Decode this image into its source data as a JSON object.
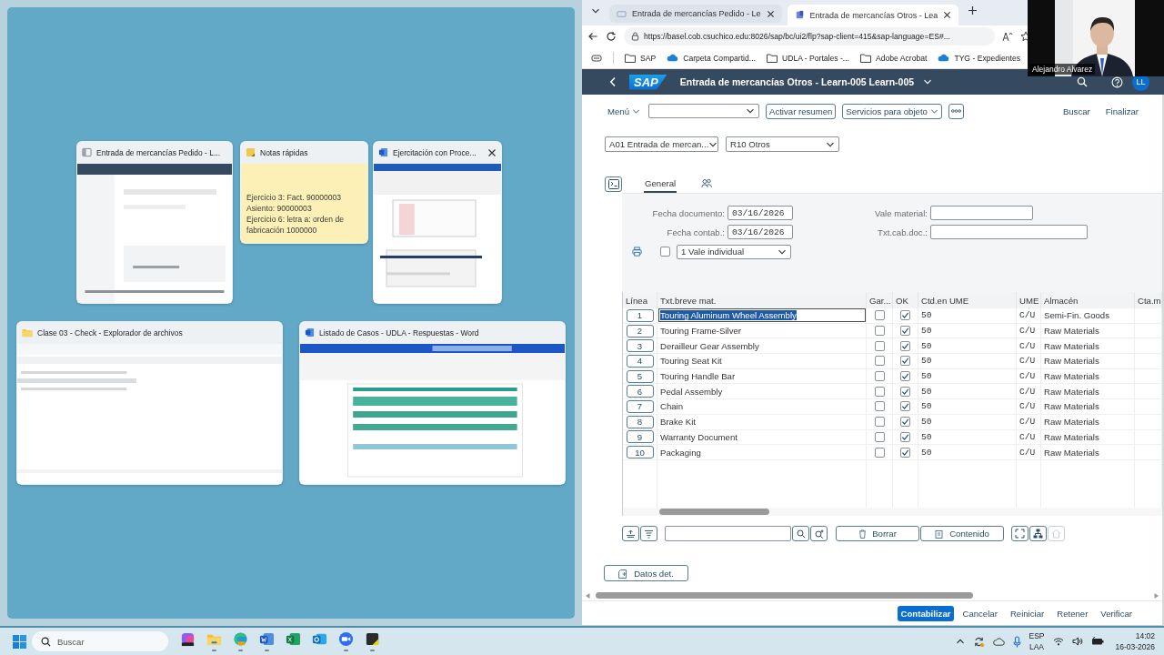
{
  "task_view": {
    "windows": [
      {
        "kind": "browser",
        "title": "Entrada de mercancías Pedido - L...",
        "hovered": false
      },
      {
        "kind": "notes",
        "title": "Notas rápidas",
        "hovered": false,
        "lines": [
          "Ejercicio 3: Fact. 90000003",
          "Asiento: 90000003",
          "Ejercicio 6: letra a: orden de fabricación 1000000"
        ]
      },
      {
        "kind": "document",
        "title": "Ejercitación con Proce...",
        "hovered": true
      },
      {
        "kind": "explorer",
        "title": "Clase 03 - Check - Explorador de archivos",
        "hovered": false
      },
      {
        "kind": "word",
        "title": "Listado de Casos - UDLA - Respuestas - Word",
        "hovered": false
      }
    ]
  },
  "webcam": {
    "name": "Alejandro Alvarez"
  },
  "browser": {
    "tabs": [
      {
        "label": "Entrada de mercancías Pedido - Le",
        "selected": false
      },
      {
        "label": "Entrada de mercancías Otros - Lea",
        "selected": true
      }
    ],
    "address": "https://basel.cob.csuchico.edu:8026/sap/bc/ui2/flp?sap-client=415&sap-language=ES#...",
    "bookmarks": [
      {
        "label": "SAP",
        "kind": "folder"
      },
      {
        "label": "Carpeta Compartid...",
        "kind": "cloud"
      },
      {
        "label": "UDLA - Portales -...",
        "kind": "folder"
      },
      {
        "label": "Adobe Acrobat",
        "kind": "folder"
      },
      {
        "label": "TYG - Expedientes",
        "kind": "cloud"
      }
    ]
  },
  "shell": {
    "logo": "SAP",
    "title": "Entrada de mercancías Otros - Learn-005 Learn-005",
    "avatar": "LL"
  },
  "toolbar": {
    "menu": "Menú",
    "buttons": [
      {
        "label": "Activar resumen",
        "kind": "plain"
      },
      {
        "label": "Servicios para objeto",
        "kind": "menu"
      }
    ],
    "links": [
      "Buscar",
      "Finalizar"
    ]
  },
  "selectors": [
    "A01 Entrada de mercan...",
    "R10 Otros"
  ],
  "tabs": [
    {
      "kind": "text",
      "label": "General",
      "selected": true
    },
    {
      "kind": "icon",
      "selected": false
    }
  ],
  "header_fields": [
    {
      "label": "Fecha documento:",
      "value": "03/16/2026"
    },
    {
      "label": "Vale material:"
    },
    {
      "label": "Fecha contab.:",
      "value": "03/16/2026"
    },
    {
      "label": "Txt.cab.doc.:"
    }
  ],
  "print": {
    "checked": false,
    "option": "1 Vale individual"
  },
  "table": {
    "columns": [
      "Línea",
      "Txt.breve mat.",
      "Gar...",
      "OK",
      "Ctd.en UME",
      "UME",
      "Almacén",
      "Cta.m"
    ],
    "rows": [
      {
        "line": "1",
        "material": "Touring Aluminum Wheel Assembly",
        "editing": true,
        "gar": false,
        "ok": true,
        "qty": "50",
        "unit": "C/U",
        "storage": "Semi-Fin. Goods"
      },
      {
        "line": "2",
        "material": "Touring Frame-Silver",
        "editing": false,
        "gar": false,
        "ok": true,
        "qty": "50",
        "unit": "C/U",
        "storage": "Raw Materials"
      },
      {
        "line": "3",
        "material": "Derailleur Gear Assembly",
        "editing": false,
        "gar": false,
        "ok": true,
        "qty": "50",
        "unit": "C/U",
        "storage": "Raw Materials"
      },
      {
        "line": "4",
        "material": "Touring Seat Kit",
        "editing": false,
        "gar": false,
        "ok": true,
        "qty": "50",
        "unit": "C/U",
        "storage": "Raw Materials"
      },
      {
        "line": "5",
        "material": "Touring Handle Bar",
        "editing": false,
        "gar": false,
        "ok": true,
        "qty": "50",
        "unit": "C/U",
        "storage": "Raw Materials"
      },
      {
        "line": "6",
        "material": "Pedal Assembly",
        "editing": false,
        "gar": false,
        "ok": true,
        "qty": "50",
        "unit": "C/U",
        "storage": "Raw Materials"
      },
      {
        "line": "7",
        "material": "Chain",
        "editing": false,
        "gar": false,
        "ok": true,
        "qty": "50",
        "unit": "C/U",
        "storage": "Raw Materials"
      },
      {
        "line": "8",
        "material": "Brake Kit",
        "editing": false,
        "gar": false,
        "ok": true,
        "qty": "50",
        "unit": "C/U",
        "storage": "Raw Materials"
      },
      {
        "line": "9",
        "material": "Warranty Document",
        "editing": false,
        "gar": false,
        "ok": true,
        "qty": "50",
        "unit": "C/U",
        "storage": "Raw Materials"
      },
      {
        "line": "10",
        "material": "Packaging",
        "editing": false,
        "gar": false,
        "ok": true,
        "qty": "50",
        "unit": "C/U",
        "storage": "Raw Materials"
      }
    ]
  },
  "table_toolbar": {
    "buttons": [
      "Borrar",
      "Contenido"
    ],
    "view_buttons": [
      {
        "kind": "fullscreen",
        "disabled": false
      },
      {
        "kind": "tree",
        "disabled": false
      },
      {
        "kind": "home",
        "disabled": true
      }
    ]
  },
  "detail_button": "Datos det.",
  "footer": [
    {
      "label": "Contabilizar",
      "kind": "primary"
    },
    {
      "label": "Cancelar",
      "kind": "link"
    },
    {
      "label": "Reiniciar",
      "kind": "link"
    },
    {
      "label": "Retener",
      "kind": "link"
    },
    {
      "label": "Verificar",
      "kind": "link"
    }
  ],
  "taskbar": {
    "search_placeholder": "Buscar",
    "apps": [
      {
        "kind": "assistant",
        "running": false
      },
      {
        "kind": "files",
        "running": true
      },
      {
        "kind": "browser",
        "running": true
      },
      {
        "kind": "word",
        "running": true
      },
      {
        "kind": "excel",
        "running": false
      },
      {
        "kind": "mail",
        "running": false
      },
      {
        "kind": "meeting",
        "running": true
      },
      {
        "kind": "notes",
        "running": true
      }
    ],
    "language": [
      "ESP",
      "LAA"
    ],
    "time": "14:02",
    "date": "16-03-2026"
  }
}
